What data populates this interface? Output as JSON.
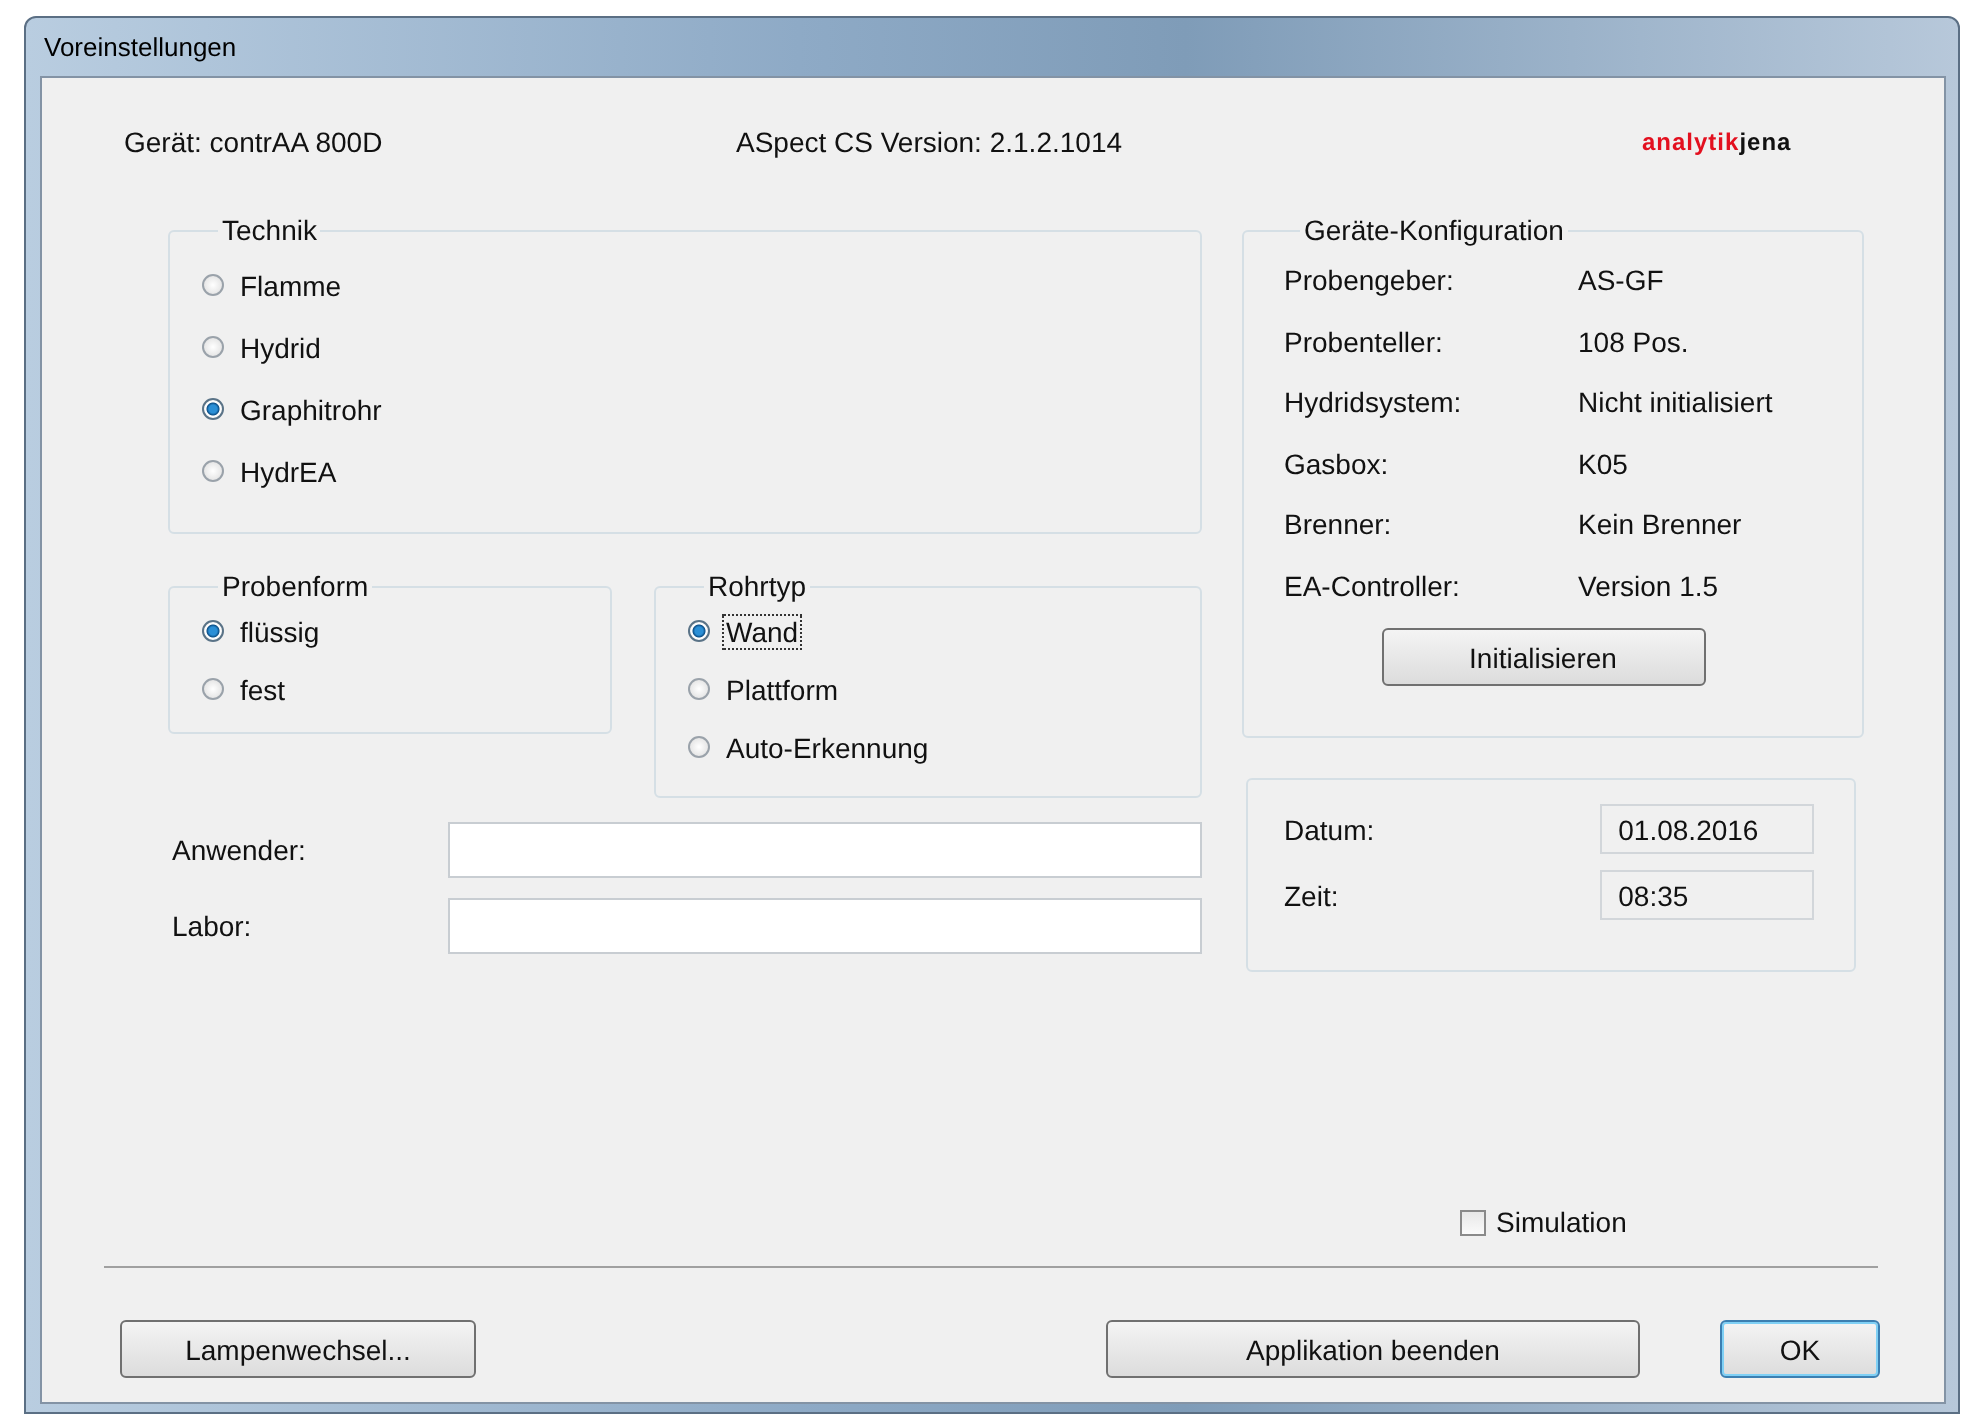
{
  "window": {
    "title": "Voreinstellungen"
  },
  "header": {
    "device": "Gerät: contrAA 800D",
    "version": "ASpect CS Version: 2.1.2.1014",
    "logo": [
      {
        "text": "analytik",
        "color": "#e3101f"
      },
      {
        "text": "jena",
        "color": "#111111"
      }
    ]
  },
  "technik": {
    "title": "Technik",
    "options": [
      {
        "label": "Flamme",
        "selected": false
      },
      {
        "label": "Hydrid",
        "selected": false
      },
      {
        "label": "Graphitrohr",
        "selected": true
      },
      {
        "label": "HydrEA",
        "selected": false
      }
    ]
  },
  "probenform": {
    "title": "Probenform",
    "options": [
      {
        "label": "flüssig",
        "selected": true
      },
      {
        "label": "fest",
        "selected": false
      }
    ]
  },
  "rohrtyp": {
    "title": "Rohrtyp",
    "options": [
      {
        "label": "Wand",
        "selected": true,
        "focused": true
      },
      {
        "label": "Plattform",
        "selected": false,
        "focused": false
      },
      {
        "label": "Auto-Erkennung",
        "selected": false,
        "focused": false
      }
    ]
  },
  "user_fields": [
    {
      "label": "Anwender:"
    },
    {
      "label": "Labor:"
    }
  ],
  "configuration": {
    "title": "Geräte-Konfiguration",
    "rows": [
      {
        "label": "Probengeber:",
        "value": "AS-GF"
      },
      {
        "label": "Probenteller:",
        "value": "108 Pos."
      },
      {
        "label": "Hydridsystem:",
        "value": "Nicht initialisiert"
      },
      {
        "label": "Gasbox:",
        "value": "K05"
      },
      {
        "label": "Brenner:",
        "value": "Kein Brenner"
      },
      {
        "label": "EA-Controller:",
        "value": "Version  1.5"
      }
    ],
    "button": "Initialisieren"
  },
  "datetime": [
    {
      "label": "Datum:",
      "value": "01.08.2016"
    },
    {
      "label": "Zeit:",
      "value": "08:35"
    }
  ],
  "simulation": {
    "label": "Simulation",
    "checked": false
  },
  "buttons": [
    {
      "label": "Lampenwechsel...",
      "default": false
    },
    {
      "label": "Applikation beenden",
      "default": false
    },
    {
      "label": "OK",
      "default": true
    }
  ]
}
